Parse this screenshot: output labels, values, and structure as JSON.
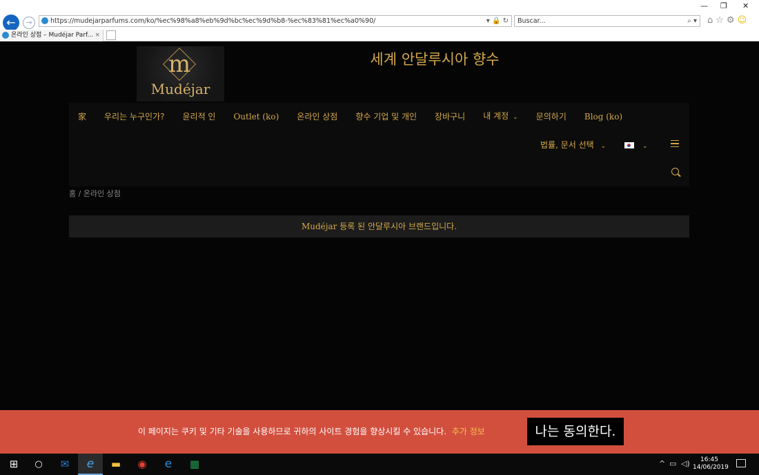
{
  "browser": {
    "url": "https://mudejarparfums.com/ko/%ec%98%a8%eb%9d%bc%ec%9d%b8-%ec%83%81%ec%a0%90/",
    "search_placeholder": "Buscar...",
    "tab_title": "온라인 상점 – Mudéjar Parf...",
    "back_icon": "back-arrow-icon",
    "forward_icon": "forward-arrow-icon"
  },
  "site": {
    "logo_text": "Mudéjar",
    "title": "세계 안달루시아 향수"
  },
  "nav": {
    "home_glyph": "家",
    "items": [
      "우리는 누구인가?",
      "윤리적 인",
      "Outlet (ko)",
      "온라인 상점",
      "향수 기업 및 개인",
      "장바구니",
      "내 계정",
      "문의하기",
      "Blog (ko)"
    ],
    "legal_select": "법률, 문서 선택",
    "language": "Korean"
  },
  "breadcrumb": "홈 / 온라인 상점",
  "notice": {
    "brand": "Mudéjar",
    "text": " 등록 된 안달루시아 브랜드입니다."
  },
  "cookie": {
    "text": "이 페이지는 쿠키 및 기타 기술을 사용하므로 귀하의 사이트 경험을 향상시킬 수 있습니다.",
    "link": "추가 정보",
    "button": "나는 동의한다."
  },
  "taskbar": {
    "time": "16:45",
    "date": "14/06/2019"
  },
  "colors": {
    "accent_gold": "#d4a84a",
    "cookie_red": "#d24f3e",
    "page_bg": "#050505"
  }
}
